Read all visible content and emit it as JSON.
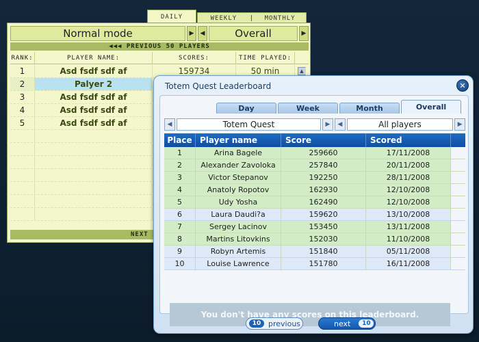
{
  "back_panel": {
    "tabs": {
      "daily": "DAILY",
      "weekly": "WEEKLY",
      "separator": "|",
      "monthly": "MONTHLY"
    },
    "mode_left": "Normal mode",
    "mode_right": "Overall",
    "prev_bar": "◀◀◀ PREVIOUS 50 PLAYERS",
    "next_bar": "NEXT 50",
    "columns": {
      "rank": "RANK:",
      "name": "PLAYER NAME:",
      "score": "SCORES:",
      "time": "TIME PLAYED:"
    },
    "rows": [
      {
        "rank": "1",
        "name": "Asd fsdf sdf af",
        "score": "159734",
        "time": "50 min"
      },
      {
        "rank": "2",
        "name": "Palyer 2",
        "score": "",
        "time": ""
      },
      {
        "rank": "3",
        "name": "Asd fsdf sdf af",
        "score": "",
        "time": ""
      },
      {
        "rank": "4",
        "name": "Asd fsdf sdf af",
        "score": "",
        "time": ""
      },
      {
        "rank": "5",
        "name": "Asd fsdf sdf af",
        "score": "",
        "time": ""
      }
    ]
  },
  "dialog": {
    "title": "Totem Quest Leaderboard",
    "close_glyph": "✕",
    "tabs": [
      "Day",
      "Week",
      "Month",
      "Overall"
    ],
    "active_tab": "Overall",
    "game_selector": "Totem Quest",
    "players_selector": "All players",
    "columns": {
      "place": "Place",
      "name": "Player name",
      "score": "Score",
      "scored": "Scored"
    },
    "rows": [
      {
        "place": "1",
        "name": "Arina Bagele",
        "score": "259660",
        "scored": "17/11/2008",
        "tint": "green"
      },
      {
        "place": "2",
        "name": "Alexander Zavoloka",
        "score": "257840",
        "scored": "20/11/2008",
        "tint": "green"
      },
      {
        "place": "3",
        "name": "Victor Stepanov",
        "score": "192250",
        "scored": "28/11/2008",
        "tint": "green"
      },
      {
        "place": "4",
        "name": "Anatoly Ropotov",
        "score": "162930",
        "scored": "12/10/2008",
        "tint": "green"
      },
      {
        "place": "5",
        "name": "Udy Yosha",
        "score": "162490",
        "scored": "12/10/2008",
        "tint": "green"
      },
      {
        "place": "6",
        "name": "Laura Daudi?a",
        "score": "159620",
        "scored": "13/10/2008",
        "tint": "blue"
      },
      {
        "place": "7",
        "name": "Sergey Lacinov",
        "score": "153450",
        "scored": "13/11/2008",
        "tint": "green"
      },
      {
        "place": "8",
        "name": "Martins Litovkins",
        "score": "152030",
        "scored": "11/10/2008",
        "tint": "green"
      },
      {
        "place": "9",
        "name": "Robyn Artemis",
        "score": "151840",
        "scored": "05/11/2008",
        "tint": "blue"
      },
      {
        "place": "10",
        "name": "Louise Lawrence",
        "score": "151780",
        "scored": "16/11/2008",
        "tint": "blue"
      }
    ],
    "message": "You don't have any scores on this leaderboard.",
    "prev_button": {
      "badge": "10",
      "label": "previous"
    },
    "next_button": {
      "badge": "10",
      "label": "next"
    }
  }
}
